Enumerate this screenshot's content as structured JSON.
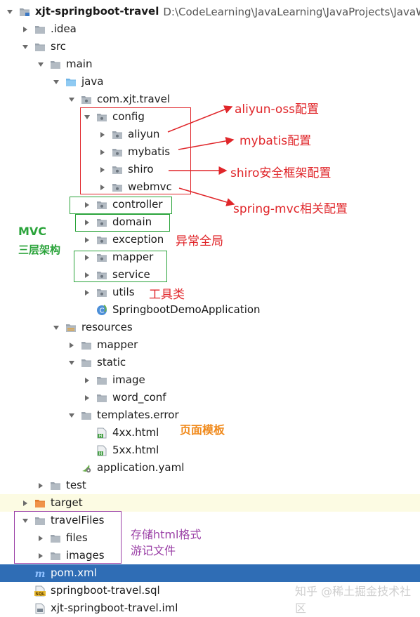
{
  "tree": {
    "project_name": "xjt-springboot-travel",
    "project_path": "D:\\CodeLearning\\JavaLearning\\JavaProjects\\JavaWe",
    "rows": [
      {
        "label": "xjt-springboot-travel",
        "icon": "project-folder-icon",
        "arrow": "down",
        "indent": 0,
        "root": true
      },
      {
        "label": ".idea",
        "icon": "folder-icon",
        "arrow": "right",
        "indent": 1
      },
      {
        "label": "src",
        "icon": "folder-icon",
        "arrow": "down",
        "indent": 1
      },
      {
        "label": "main",
        "icon": "folder-icon",
        "arrow": "down",
        "indent": 2
      },
      {
        "label": "java",
        "icon": "source-folder-icon",
        "arrow": "down",
        "indent": 3
      },
      {
        "label": "com.xjt.travel",
        "icon": "package-icon",
        "arrow": "down",
        "indent": 4
      },
      {
        "label": "config",
        "icon": "package-icon",
        "arrow": "down",
        "indent": 5
      },
      {
        "label": "aliyun",
        "icon": "package-icon",
        "arrow": "right",
        "indent": 6
      },
      {
        "label": "mybatis",
        "icon": "package-icon",
        "arrow": "right",
        "indent": 6
      },
      {
        "label": "shiro",
        "icon": "package-icon",
        "arrow": "right",
        "indent": 6
      },
      {
        "label": "webmvc",
        "icon": "package-icon",
        "arrow": "right",
        "indent": 6
      },
      {
        "label": "controller",
        "icon": "package-icon",
        "arrow": "right",
        "indent": 5
      },
      {
        "label": "domain",
        "icon": "package-icon",
        "arrow": "right",
        "indent": 5
      },
      {
        "label": "exception",
        "icon": "package-icon",
        "arrow": "right",
        "indent": 5
      },
      {
        "label": "mapper",
        "icon": "package-icon",
        "arrow": "right",
        "indent": 5
      },
      {
        "label": "service",
        "icon": "package-icon",
        "arrow": "right",
        "indent": 5
      },
      {
        "label": "utils",
        "icon": "package-icon",
        "arrow": "right",
        "indent": 5
      },
      {
        "label": "SpringbootDemoApplication",
        "icon": "spring-class-icon",
        "arrow": "none",
        "indent": 5
      },
      {
        "label": "resources",
        "icon": "resources-folder-icon",
        "arrow": "down",
        "indent": 3
      },
      {
        "label": "mapper",
        "icon": "folder-icon",
        "arrow": "right",
        "indent": 4
      },
      {
        "label": "static",
        "icon": "folder-icon",
        "arrow": "down",
        "indent": 4
      },
      {
        "label": "image",
        "icon": "folder-icon",
        "arrow": "right",
        "indent": 5
      },
      {
        "label": "word_conf",
        "icon": "folder-icon",
        "arrow": "right",
        "indent": 5
      },
      {
        "label": "templates.error",
        "icon": "folder-icon",
        "arrow": "down",
        "indent": 4
      },
      {
        "label": "4xx.html",
        "icon": "html-file-icon",
        "arrow": "none",
        "indent": 5
      },
      {
        "label": "5xx.html",
        "icon": "html-file-icon",
        "arrow": "none",
        "indent": 5
      },
      {
        "label": "application.yaml",
        "icon": "yaml-file-icon",
        "arrow": "none",
        "indent": 4
      },
      {
        "label": "test",
        "icon": "folder-icon",
        "arrow": "right",
        "indent": 2
      },
      {
        "label": "target",
        "icon": "target-folder-icon",
        "arrow": "right",
        "indent": 1,
        "highlight": "yellow"
      },
      {
        "label": "travelFiles",
        "icon": "folder-icon",
        "arrow": "down",
        "indent": 1
      },
      {
        "label": "files",
        "icon": "folder-icon",
        "arrow": "right",
        "indent": 2
      },
      {
        "label": "images",
        "icon": "folder-icon",
        "arrow": "right",
        "indent": 2
      },
      {
        "label": "pom.xml",
        "icon": "maven-file-icon",
        "arrow": "none",
        "indent": 1,
        "highlight": "blue"
      },
      {
        "label": "springboot-travel.sql",
        "icon": "sql-file-icon",
        "arrow": "none",
        "indent": 1
      },
      {
        "label": "xjt-springboot-travel.iml",
        "icon": "iml-file-icon",
        "arrow": "none",
        "indent": 1
      }
    ]
  },
  "annotations": {
    "aliyun": "aliyun-oss配置",
    "mybatis": "mybatis配置",
    "shiro": "shiro安全框架配置",
    "webmvc": "spring-mvc相关配置",
    "mvc_title": "MVC",
    "mvc_sub": "三层架构",
    "exception": "异常全局",
    "utils": "工具类",
    "templates": "页面模板",
    "travel_files_line1": "存储html格式",
    "travel_files_line2": "游记文件"
  },
  "watermark": "知乎 @稀土掘金技术社区",
  "colors": {
    "red": "#e0262a",
    "green": "#2aa33a",
    "orange": "#f08a1c",
    "purple": "#9a3fa6",
    "selected": "#2f6db5",
    "highlight": "#fcfbe3"
  }
}
